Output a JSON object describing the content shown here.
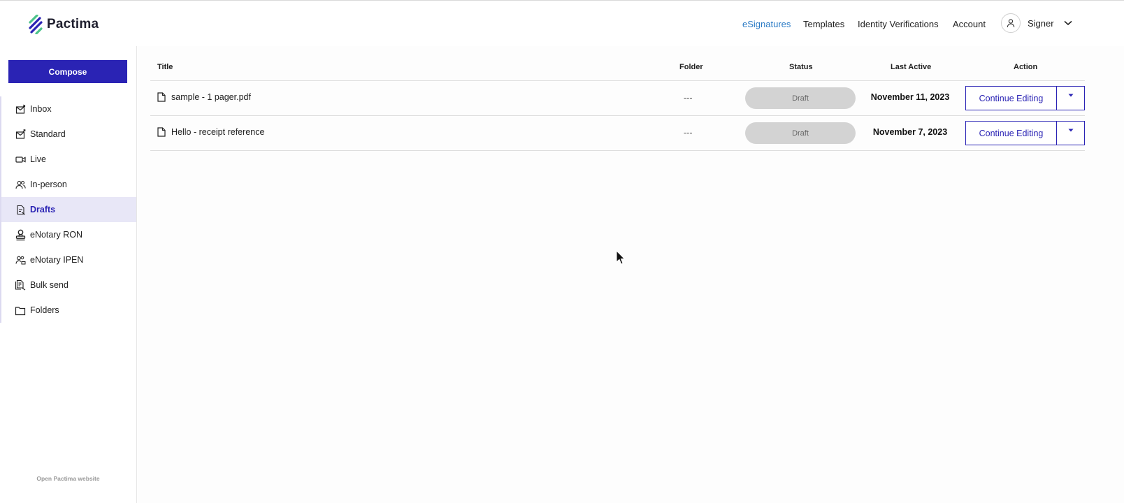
{
  "app": {
    "name": "Pactima",
    "brand_color": "#2a23b4",
    "link_color": "#2b7bc5"
  },
  "header": {
    "nav": [
      {
        "label": "eSignatures",
        "active": true
      },
      {
        "label": "Templates",
        "active": false
      },
      {
        "label": "Identity Verifications",
        "active": false
      },
      {
        "label": "Account",
        "active": false
      }
    ],
    "user": {
      "label": "Signer",
      "icon": "user-icon",
      "chevron": "chevron-down-icon"
    }
  },
  "sidebar": {
    "compose_label": "Compose",
    "items": [
      {
        "label": "Inbox",
        "icon": "inbox-icon",
        "active": false
      },
      {
        "label": "Standard",
        "icon": "outbox-icon",
        "active": false
      },
      {
        "label": "Live",
        "icon": "video-icon",
        "active": false
      },
      {
        "label": "In-person",
        "icon": "users-icon",
        "active": false
      },
      {
        "label": "Drafts",
        "icon": "draft-icon",
        "active": true
      },
      {
        "label": "eNotary RON",
        "icon": "stamp-icon",
        "active": false
      },
      {
        "label": "eNotary IPEN",
        "icon": "notary-person-icon",
        "active": false
      },
      {
        "label": "Bulk send",
        "icon": "bulk-send-icon",
        "active": false
      },
      {
        "label": "Folders",
        "icon": "folder-icon",
        "active": false
      }
    ],
    "footer_link": "Open Pactima website"
  },
  "table": {
    "columns": [
      "Title",
      "Folder",
      "Status",
      "Last Active",
      "Action"
    ],
    "rows": [
      {
        "title": "sample - 1 pager.pdf",
        "folder": "---",
        "status": "Draft",
        "last_active": "November 11, 2023",
        "action": "Continue Editing"
      },
      {
        "title": "Hello - receipt reference",
        "folder": "---",
        "status": "Draft",
        "last_active": "November 7, 2023",
        "action": "Continue Editing"
      }
    ]
  }
}
